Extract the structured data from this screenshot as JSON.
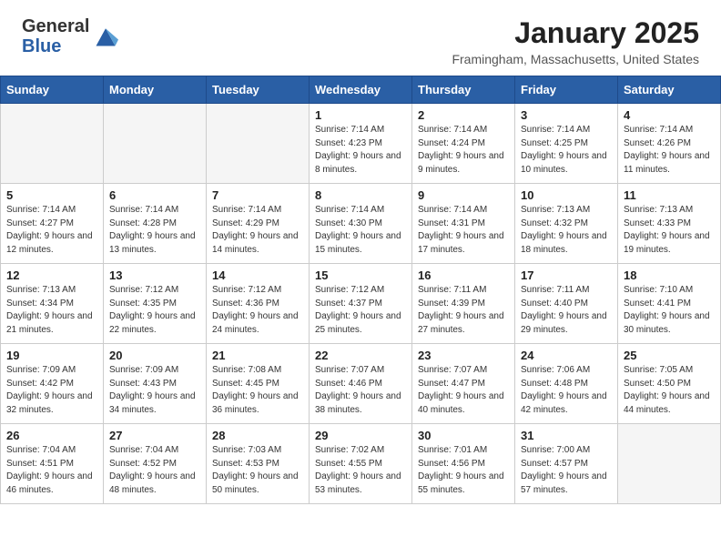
{
  "header": {
    "logo_general": "General",
    "logo_blue": "Blue",
    "month": "January 2025",
    "location": "Framingham, Massachusetts, United States"
  },
  "days_of_week": [
    "Sunday",
    "Monday",
    "Tuesday",
    "Wednesday",
    "Thursday",
    "Friday",
    "Saturday"
  ],
  "weeks": [
    [
      {
        "day": "",
        "empty": true
      },
      {
        "day": "",
        "empty": true
      },
      {
        "day": "",
        "empty": true
      },
      {
        "day": "1",
        "sunrise": "7:14 AM",
        "sunset": "4:23 PM",
        "daylight": "9 hours and 8 minutes."
      },
      {
        "day": "2",
        "sunrise": "7:14 AM",
        "sunset": "4:24 PM",
        "daylight": "9 hours and 9 minutes."
      },
      {
        "day": "3",
        "sunrise": "7:14 AM",
        "sunset": "4:25 PM",
        "daylight": "9 hours and 10 minutes."
      },
      {
        "day": "4",
        "sunrise": "7:14 AM",
        "sunset": "4:26 PM",
        "daylight": "9 hours and 11 minutes."
      }
    ],
    [
      {
        "day": "5",
        "sunrise": "7:14 AM",
        "sunset": "4:27 PM",
        "daylight": "9 hours and 12 minutes."
      },
      {
        "day": "6",
        "sunrise": "7:14 AM",
        "sunset": "4:28 PM",
        "daylight": "9 hours and 13 minutes."
      },
      {
        "day": "7",
        "sunrise": "7:14 AM",
        "sunset": "4:29 PM",
        "daylight": "9 hours and 14 minutes."
      },
      {
        "day": "8",
        "sunrise": "7:14 AM",
        "sunset": "4:30 PM",
        "daylight": "9 hours and 15 minutes."
      },
      {
        "day": "9",
        "sunrise": "7:14 AM",
        "sunset": "4:31 PM",
        "daylight": "9 hours and 17 minutes."
      },
      {
        "day": "10",
        "sunrise": "7:13 AM",
        "sunset": "4:32 PM",
        "daylight": "9 hours and 18 minutes."
      },
      {
        "day": "11",
        "sunrise": "7:13 AM",
        "sunset": "4:33 PM",
        "daylight": "9 hours and 19 minutes."
      }
    ],
    [
      {
        "day": "12",
        "sunrise": "7:13 AM",
        "sunset": "4:34 PM",
        "daylight": "9 hours and 21 minutes."
      },
      {
        "day": "13",
        "sunrise": "7:12 AM",
        "sunset": "4:35 PM",
        "daylight": "9 hours and 22 minutes."
      },
      {
        "day": "14",
        "sunrise": "7:12 AM",
        "sunset": "4:36 PM",
        "daylight": "9 hours and 24 minutes."
      },
      {
        "day": "15",
        "sunrise": "7:12 AM",
        "sunset": "4:37 PM",
        "daylight": "9 hours and 25 minutes."
      },
      {
        "day": "16",
        "sunrise": "7:11 AM",
        "sunset": "4:39 PM",
        "daylight": "9 hours and 27 minutes."
      },
      {
        "day": "17",
        "sunrise": "7:11 AM",
        "sunset": "4:40 PM",
        "daylight": "9 hours and 29 minutes."
      },
      {
        "day": "18",
        "sunrise": "7:10 AM",
        "sunset": "4:41 PM",
        "daylight": "9 hours and 30 minutes."
      }
    ],
    [
      {
        "day": "19",
        "sunrise": "7:09 AM",
        "sunset": "4:42 PM",
        "daylight": "9 hours and 32 minutes."
      },
      {
        "day": "20",
        "sunrise": "7:09 AM",
        "sunset": "4:43 PM",
        "daylight": "9 hours and 34 minutes."
      },
      {
        "day": "21",
        "sunrise": "7:08 AM",
        "sunset": "4:45 PM",
        "daylight": "9 hours and 36 minutes."
      },
      {
        "day": "22",
        "sunrise": "7:07 AM",
        "sunset": "4:46 PM",
        "daylight": "9 hours and 38 minutes."
      },
      {
        "day": "23",
        "sunrise": "7:07 AM",
        "sunset": "4:47 PM",
        "daylight": "9 hours and 40 minutes."
      },
      {
        "day": "24",
        "sunrise": "7:06 AM",
        "sunset": "4:48 PM",
        "daylight": "9 hours and 42 minutes."
      },
      {
        "day": "25",
        "sunrise": "7:05 AM",
        "sunset": "4:50 PM",
        "daylight": "9 hours and 44 minutes."
      }
    ],
    [
      {
        "day": "26",
        "sunrise": "7:04 AM",
        "sunset": "4:51 PM",
        "daylight": "9 hours and 46 minutes."
      },
      {
        "day": "27",
        "sunrise": "7:04 AM",
        "sunset": "4:52 PM",
        "daylight": "9 hours and 48 minutes."
      },
      {
        "day": "28",
        "sunrise": "7:03 AM",
        "sunset": "4:53 PM",
        "daylight": "9 hours and 50 minutes."
      },
      {
        "day": "29",
        "sunrise": "7:02 AM",
        "sunset": "4:55 PM",
        "daylight": "9 hours and 53 minutes."
      },
      {
        "day": "30",
        "sunrise": "7:01 AM",
        "sunset": "4:56 PM",
        "daylight": "9 hours and 55 minutes."
      },
      {
        "day": "31",
        "sunrise": "7:00 AM",
        "sunset": "4:57 PM",
        "daylight": "9 hours and 57 minutes."
      },
      {
        "day": "",
        "empty": true
      }
    ]
  ]
}
